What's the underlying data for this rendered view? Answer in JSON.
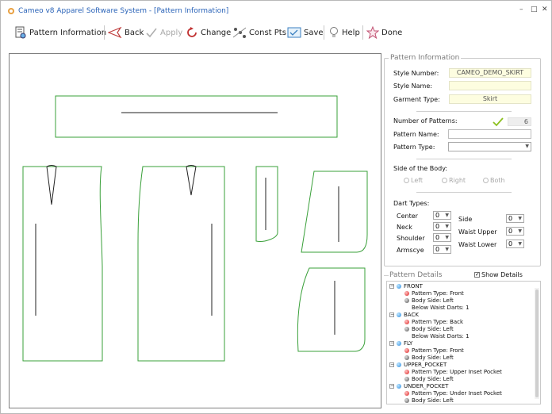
{
  "window": {
    "title": "Cameo v8 Apparel Software System - [Pattern Information]",
    "controls": [
      "–",
      "□",
      "✕"
    ]
  },
  "toolbar": {
    "pattern_information": "Pattern Information",
    "back": "Back",
    "apply": "Apply",
    "change": "Change",
    "const_pts": "Const Pts",
    "save": "Save",
    "help": "Help",
    "done": "Done"
  },
  "pattern_information": {
    "title": "Pattern Information",
    "style_number_label": "Style Number:",
    "style_number_value": "CAMEO_DEMO_SKIRT",
    "style_name_label": "Style Name:",
    "style_name_value": "",
    "garment_type_label": "Garment Type:",
    "garment_type_value": "Skirt",
    "number_of_patterns_label": "Number of Patterns:",
    "number_of_patterns_value": "6",
    "pattern_name_label": "Pattern Name:",
    "pattern_name_value": "",
    "pattern_type_label": "Pattern Type:",
    "pattern_type_value": "",
    "side_of_body_label": "Side of the Body:",
    "side_options": [
      "Left",
      "Right",
      "Both"
    ],
    "dart_types_label": "Dart Types:",
    "darts": {
      "center_label": "Center",
      "center_value": "0",
      "neck_label": "Neck",
      "neck_value": "0",
      "shoulder_label": "Shoulder",
      "shoulder_value": "0",
      "armscye_label": "Armscye",
      "armscye_value": "0",
      "side_label": "Side",
      "side_value": "0",
      "waist_upper_label": "Waist Upper",
      "waist_upper_value": "0",
      "waist_lower_label": "Waist Lower",
      "waist_lower_value": "0"
    }
  },
  "pattern_details": {
    "title": "Pattern Details",
    "show_details_label": "Show Details",
    "show_details_checked": true,
    "tree": [
      {
        "name": "FRONT",
        "children": [
          {
            "icon": "red",
            "text": "Pattern Type: Front"
          },
          {
            "icon": "grey",
            "text": "Body Side: Left"
          },
          {
            "icon": "none",
            "text": "Below Waist Darts: 1"
          }
        ]
      },
      {
        "name": "BACK",
        "children": [
          {
            "icon": "red",
            "text": "Pattern Type: Back"
          },
          {
            "icon": "grey",
            "text": "Body Side: Left"
          },
          {
            "icon": "none",
            "text": "Below Waist Darts: 1"
          }
        ]
      },
      {
        "name": "FLY",
        "children": [
          {
            "icon": "red",
            "text": "Pattern Type: Front"
          },
          {
            "icon": "grey",
            "text": "Body Side: Left"
          }
        ]
      },
      {
        "name": "UPPER_POCKET",
        "children": [
          {
            "icon": "red",
            "text": "Pattern Type: Upper Inset Pocket"
          },
          {
            "icon": "grey",
            "text": "Body Side: Left"
          }
        ]
      },
      {
        "name": "UNDER_POCKET",
        "children": [
          {
            "icon": "red",
            "text": "Pattern Type: Under Inset Pocket"
          },
          {
            "icon": "grey",
            "text": "Body Side: Left"
          }
        ]
      }
    ]
  },
  "colors": {
    "pattern_outline": "#3aa03a",
    "title_text": "#2a63b8",
    "field_bg": "#fdfde0"
  }
}
